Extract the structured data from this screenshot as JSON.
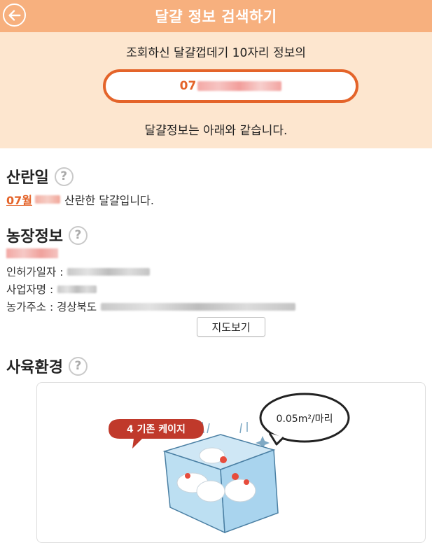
{
  "header": {
    "title": "달걀 정보 검색하기",
    "back_icon": "arrow-left-icon"
  },
  "info": {
    "line1": "조회하신 달걀껍데기 10자리 정보의",
    "code_prefix": "07",
    "line2": "달걀정보는 아래와 같습니다."
  },
  "laying": {
    "title": "산란일",
    "month": "07월",
    "suffix": "산란한 달걀입니다."
  },
  "farm": {
    "title": "농장정보",
    "permit_label": "인허가일자 :",
    "business_label": "사업자명 :",
    "address_label": "농가주소 : 경상북도",
    "map_button": "지도보기"
  },
  "environment": {
    "title": "사육환경",
    "badge": "4 기존 케이지",
    "bubble": "0.05m²/마리"
  },
  "help_label": "?",
  "colors": {
    "header_bg": "#f7b07e",
    "info_bg": "#fde6cf",
    "accent": "#e4642a",
    "badge": "#c0392b"
  }
}
